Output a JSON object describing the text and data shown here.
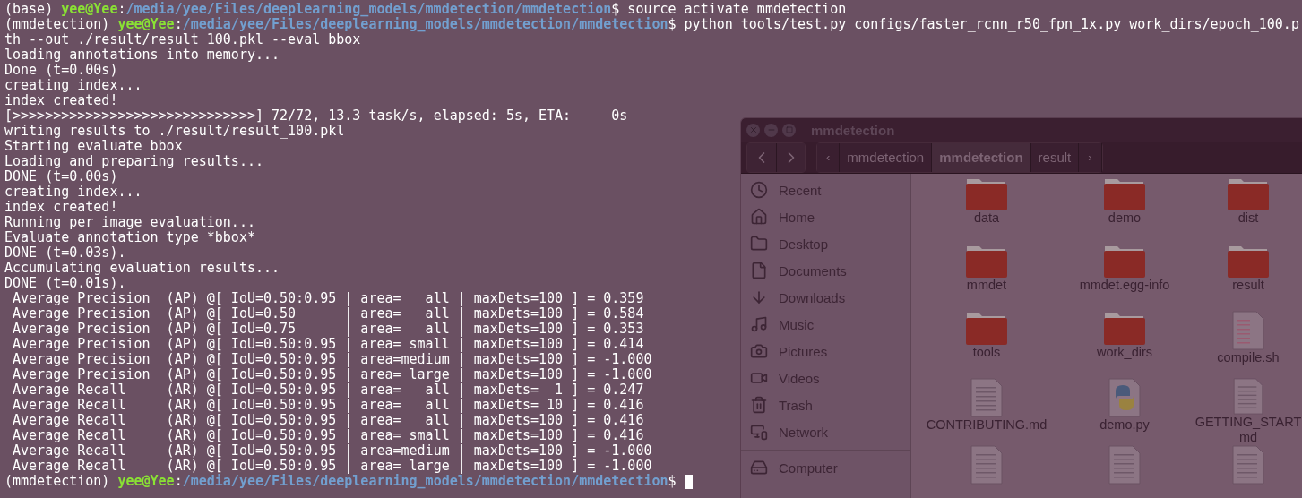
{
  "terminal": {
    "lines": [
      {
        "kind": "prompt",
        "env": "(base)",
        "user": "yee@Yee",
        "separator": ":",
        "path": "/media/yee/Files/deeplearning_models/mmdetection/mmdetection",
        "symbol": "$",
        "command": "source activate mmdetection"
      },
      {
        "kind": "prompt",
        "env": "(mmdetection)",
        "user": "yee@Yee",
        "separator": ":",
        "path": "/media/yee/Files/deeplearning_models/mmdetection/mmdetection",
        "symbol": "$",
        "command": "python tools/test.py configs/faster_rcnn_r50_fpn_1x.py work_dirs/epoch_100.p"
      },
      {
        "kind": "output",
        "text": "th --out ./result/result_100.pkl --eval bbox"
      },
      {
        "kind": "output",
        "text": "loading annotations into memory..."
      },
      {
        "kind": "output",
        "text": "Done (t=0.00s)"
      },
      {
        "kind": "output",
        "text": "creating index..."
      },
      {
        "kind": "output",
        "text": "index created!"
      },
      {
        "kind": "output",
        "text": "[>>>>>>>>>>>>>>>>>>>>>>>>>>>>>>] 72/72, 13.3 task/s, elapsed: 5s, ETA:     0s"
      },
      {
        "kind": "output",
        "text": "writing results to ./result/result_100.pkl"
      },
      {
        "kind": "output",
        "text": "Starting evaluate bbox"
      },
      {
        "kind": "output",
        "text": "Loading and preparing results..."
      },
      {
        "kind": "output",
        "text": "DONE (t=0.00s)"
      },
      {
        "kind": "output",
        "text": "creating index..."
      },
      {
        "kind": "output",
        "text": "index created!"
      },
      {
        "kind": "output",
        "text": "Running per image evaluation..."
      },
      {
        "kind": "output",
        "text": "Evaluate annotation type *bbox*"
      },
      {
        "kind": "output",
        "text": "DONE (t=0.03s)."
      },
      {
        "kind": "output",
        "text": "Accumulating evaluation results..."
      },
      {
        "kind": "output",
        "text": "DONE (t=0.01s)."
      },
      {
        "kind": "output",
        "text": " Average Precision  (AP) @[ IoU=0.50:0.95 | area=   all | maxDets=100 ] = 0.359"
      },
      {
        "kind": "output",
        "text": " Average Precision  (AP) @[ IoU=0.50      | area=   all | maxDets=100 ] = 0.584"
      },
      {
        "kind": "output",
        "text": " Average Precision  (AP) @[ IoU=0.75      | area=   all | maxDets=100 ] = 0.353"
      },
      {
        "kind": "output",
        "text": " Average Precision  (AP) @[ IoU=0.50:0.95 | area= small | maxDets=100 ] = 0.414"
      },
      {
        "kind": "output",
        "text": " Average Precision  (AP) @[ IoU=0.50:0.95 | area=medium | maxDets=100 ] = -1.000"
      },
      {
        "kind": "output",
        "text": " Average Precision  (AP) @[ IoU=0.50:0.95 | area= large | maxDets=100 ] = -1.000"
      },
      {
        "kind": "output",
        "text": " Average Recall     (AR) @[ IoU=0.50:0.95 | area=   all | maxDets=  1 ] = 0.247"
      },
      {
        "kind": "output",
        "text": " Average Recall     (AR) @[ IoU=0.50:0.95 | area=   all | maxDets= 10 ] = 0.416"
      },
      {
        "kind": "output",
        "text": " Average Recall     (AR) @[ IoU=0.50:0.95 | area=   all | maxDets=100 ] = 0.416"
      },
      {
        "kind": "output",
        "text": " Average Recall     (AR) @[ IoU=0.50:0.95 | area= small | maxDets=100 ] = 0.416"
      },
      {
        "kind": "output",
        "text": " Average Recall     (AR) @[ IoU=0.50:0.95 | area=medium | maxDets=100 ] = -1.000"
      },
      {
        "kind": "output",
        "text": " Average Recall     (AR) @[ IoU=0.50:0.95 | area= large | maxDets=100 ] = -1.000"
      },
      {
        "kind": "prompt",
        "env": "(mmdetection)",
        "user": "yee@Yee",
        "separator": ":",
        "path": "/media/yee/Files/deeplearning_models/mmdetection/mmdetection",
        "symbol": "$",
        "cursor": true
      }
    ]
  },
  "file_manager": {
    "title": "mmdetection",
    "breadcrumb": [
      {
        "label": "‹",
        "kind": "arrow",
        "selected": false
      },
      {
        "label": "mmdetection",
        "kind": "crumb",
        "selected": false
      },
      {
        "label": "mmdetection",
        "kind": "crumb",
        "selected": true
      },
      {
        "label": "result",
        "kind": "crumb",
        "selected": false
      },
      {
        "label": "›",
        "kind": "arrow",
        "selected": false
      }
    ],
    "sidebar": [
      {
        "label": "Recent",
        "kind": "recent"
      },
      {
        "label": "Home",
        "kind": "home"
      },
      {
        "label": "Desktop",
        "kind": "desktop"
      },
      {
        "label": "Documents",
        "kind": "documents"
      },
      {
        "label": "Downloads",
        "kind": "downloads"
      },
      {
        "label": "Music",
        "kind": "music"
      },
      {
        "label": "Pictures",
        "kind": "pictures"
      },
      {
        "label": "Videos",
        "kind": "videos"
      },
      {
        "label": "Trash",
        "kind": "trash"
      },
      {
        "label": "Network",
        "kind": "network"
      },
      {
        "label": "Computer",
        "kind": "computer"
      }
    ],
    "files": [
      {
        "name": "data",
        "kind": "folder"
      },
      {
        "name": "demo",
        "kind": "folder"
      },
      {
        "name": "dist",
        "kind": "folder"
      },
      {
        "name": "mmdet",
        "kind": "folder"
      },
      {
        "name": "mmdet.egg-info",
        "kind": "folder"
      },
      {
        "name": "result",
        "kind": "folder"
      },
      {
        "name": "tools",
        "kind": "folder"
      },
      {
        "name": "work_dirs",
        "kind": "folder"
      },
      {
        "name": "compile.sh",
        "kind": "script"
      },
      {
        "name": "CONTRIBUTING.md",
        "kind": "document"
      },
      {
        "name": "demo.py",
        "kind": "python"
      },
      {
        "name": "GETTING_START\nmd",
        "kind": "document"
      },
      {
        "kind": "document"
      },
      {
        "kind": "document"
      },
      {
        "kind": "document"
      }
    ]
  }
}
